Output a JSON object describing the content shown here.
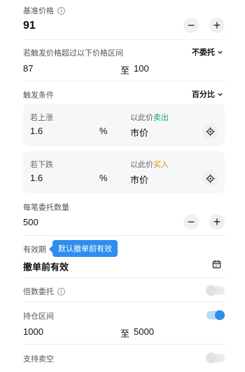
{
  "base_price": {
    "label": "基准价格",
    "info_icon": "info-icon",
    "value": "91",
    "minus": "−",
    "plus": "+"
  },
  "price_range": {
    "label": "若触发价格超过以下价格区间",
    "dropdown": "不委托",
    "low": "87",
    "separator": "至",
    "high": "100"
  },
  "trigger": {
    "label": "触发条件",
    "dropdown": "百分比",
    "rise": {
      "label": "若上涨",
      "value": "1.6",
      "unit": "%",
      "price_label": "以此价",
      "action": "卖出",
      "price_value": "市价"
    },
    "fall": {
      "label": "若下跌",
      "value": "1.6",
      "unit": "%",
      "price_label": "以此价",
      "action": "买入",
      "price_value": "市价"
    }
  },
  "quantity": {
    "label": "每笔委托数量",
    "value": "500",
    "minus": "−",
    "plus": "+"
  },
  "validity": {
    "label": "有效期",
    "tooltip": "默认撤单前有效",
    "value": "撤单前有效"
  },
  "multiple": {
    "label": "倍数委托",
    "info_icon": "info-icon",
    "enabled": false
  },
  "position_range": {
    "label": "持仓区间",
    "enabled": true,
    "low": "1000",
    "separator": "至",
    "high": "5000"
  },
  "short_sell": {
    "label": "支持卖空",
    "enabled": false
  },
  "colors": {
    "sell": "#1aa96a",
    "buy": "#e8890c",
    "accent": "#2e8ee8"
  }
}
